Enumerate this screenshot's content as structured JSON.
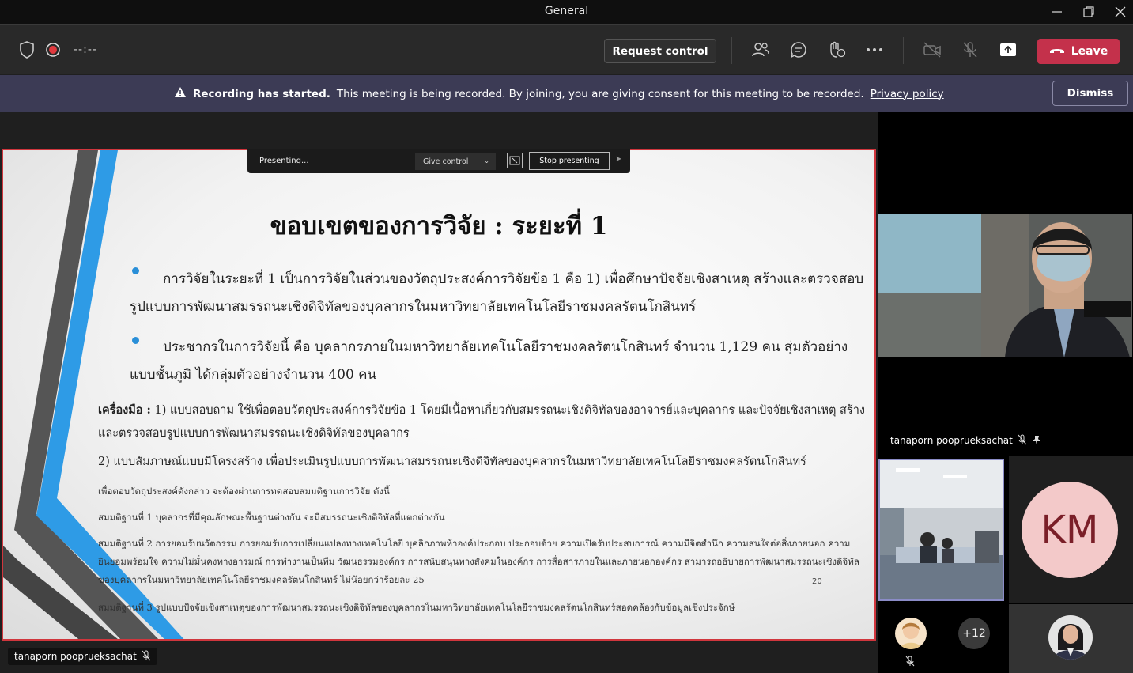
{
  "window": {
    "title": "General"
  },
  "toolbar": {
    "timer": "--:--",
    "request_control": "Request control",
    "leave": "Leave"
  },
  "banner": {
    "bold": "Recording has started.",
    "text": "This meeting is being recorded. By joining, you are giving consent for this meeting to be recorded.",
    "link": "Privacy policy",
    "dismiss": "Dismiss"
  },
  "presenting_bar": {
    "status": "Presenting...",
    "give_control": "Give control",
    "stop": "Stop presenting"
  },
  "slide": {
    "title": "ขอบเขตของการวิจัย : ระยะที่ 1",
    "bullet1": "การวิจัยในระยะที่ 1  เป็นการวิจัยในส่วนของวัตถุประสงค์การวิจัยข้อ 1 คือ 1) เพื่อศึกษาปัจจัยเชิงสาเหตุ สร้างและตรวจสอบรูปแบบการพัฒนาสมรรถนะเชิงดิจิทัลของบุคลากรในมหาวิทยาลัยเทคโนโลยีราชมงคลรัตนโกสินทร์",
    "bullet2": "ประชากรในการวิจัยนี้ คือ บุคลากรภายในมหาวิทยาลัยเทคโนโลยีราชมงคลรัตนโกสินทร์ จำนวน 1,129 คน สุ่มตัวอย่างแบบชั้นภูมิ ได้กลุ่มตัวอย่างจำนวน 400 คน",
    "tools_label": "เครื่องมือ :",
    "tools1": " 1) แบบสอบถาม ใช้เพื่อตอบวัตถุประสงค์การวิจัยข้อ 1 โดยมีเนื้อหาเกี่ยวกับสมรรถนะเชิงดิจิทัลของอาจารย์และบุคลากร และปัจจัยเชิงสาเหตุ สร้างและตรวจสอบรูปแบบการพัฒนาสมรรถนะเชิงดิจิทัลของบุคลากร",
    "tools2": "2) แบบสัมภาษณ์แบบมีโครงสร้าง เพื่อประเมินรูปแบบการพัฒนาสมรรถนะเชิงดิจิทัลของบุคลากรในมหาวิทยาลัยเทคโนโลยีราชมงคลรัตนโกสินทร์",
    "line1": "เพื่อตอบวัตถุประสงค์ดังกล่าว จะต้องผ่านการทดสอบสมมติฐานการวิจัย ดังนี้",
    "line2": "สมมติฐานที่ 1 บุคลากรที่มีคุณลักษณะพื้นฐานต่างกัน จะมีสมรรถนะเชิงดิจิทัลที่แตกต่างกัน",
    "line3": "สมมติฐานที่ 2 การยอมรับนวัตกรรม การยอมรับการเปลี่ยนแปลงทางเทคโนโลยี บุคลิกภาพห้าองค์ประกอบ ประกอบด้วย ความเปิดรับประสบการณ์ ความมีจิตสำนึก ความสนใจต่อสิ่งภายนอก ความยินยอมพร้อมใจ ความไม่มั่นคงทางอารมณ์  การทำงานเป็นทีม วัฒนธรรมองค์กร การสนับสนุนทางสังคมในองค์กร การสื่อสารภายในและภายนอกองค์กร สามารถอธิบายการพัฒนาสมรรถนะเชิงดิจิทัลของบุคลากรในมหาวิทยาลัยเทคโนโลยีราชมงคลรัตนโกสินทร์ ไม่น้อยกว่าร้อยละ 25",
    "line4": "สมมติฐานที่ 3 รูปแบบปัจจัยเชิงสาเหตุของการพัฒนาสมรรถนะเชิงดิจิทัลของบุคลากรในมหาวิทยาลัยเทคโนโลยีราชมงคลรัตนโกสินทร์สอดคล้องกับข้อมูลเชิงประจักษ์",
    "page": "20"
  },
  "participants": {
    "presenter_name": "tanaporn pooprueksachat",
    "main_video_name": "tanaporn pooprueksachat",
    "km_initials": "KM",
    "more_count": "+12"
  },
  "colors": {
    "leave": "#c4314b",
    "banner": "#3c3b55",
    "accent_border": "#d0363d"
  }
}
